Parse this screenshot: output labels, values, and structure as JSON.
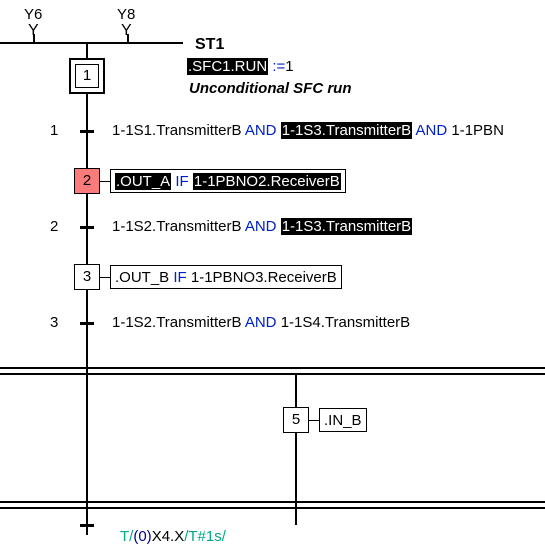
{
  "labels": {
    "y6": "Y6",
    "y8": "Y8"
  },
  "header": {
    "title": "ST1",
    "cmd_left": ".SFC1.RUN",
    "cmd_op": ":=",
    "cmd_right": "1",
    "comment": "Unconditional SFC run"
  },
  "steps": {
    "s1": "1",
    "s2": "2",
    "s3": "3",
    "s5": "5"
  },
  "transitions": {
    "t1_label": "1",
    "t2_label": "2",
    "t3_label": "3"
  },
  "expr_t1": {
    "p1": "1-1S1.TransmitterB",
    "and1": "AND",
    "p2": "1-1S3.TransmitterB",
    "and2": "AND",
    "p3": "1-1PBN"
  },
  "action_s2": {
    "out": ".OUT_A",
    "if": "IF",
    "cond": "1-1PBNO2.ReceiverB"
  },
  "expr_t2": {
    "p1": "1-1S2.TransmitterB",
    "and1": "AND",
    "p2": "1-1S3.TransmitterB"
  },
  "action_s3": {
    "out": ".OUT_B",
    "if": "IF",
    "cond": "1-1PBNO3.ReceiverB"
  },
  "expr_t3": {
    "p1": "1-1S2.TransmitterB",
    "and1": "AND",
    "p2": "1-1S4.TransmitterB"
  },
  "action_s5": {
    "text": ".IN_B"
  },
  "bottom": {
    "a": "T/",
    "b": "(0)",
    "c": "X4.X",
    "d": "/T#1s/"
  }
}
